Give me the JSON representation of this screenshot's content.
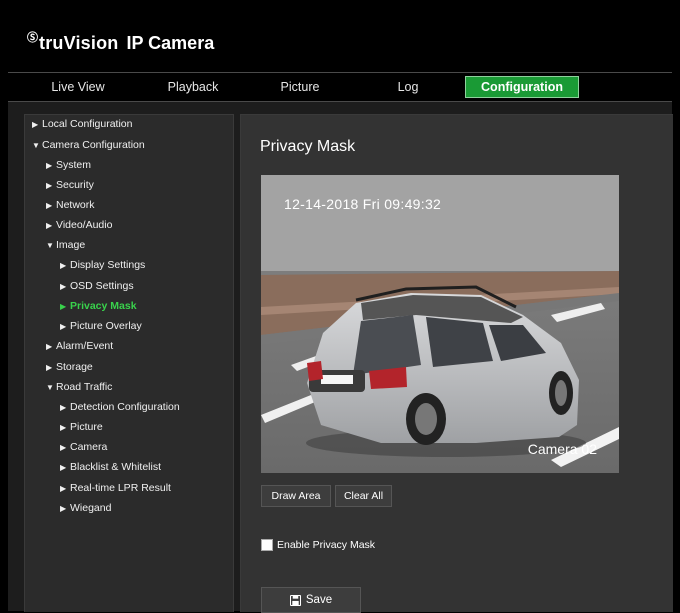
{
  "brand": {
    "mark": "Ⓢ",
    "name": "truVision",
    "product": "IP Camera"
  },
  "nav": {
    "tabs": [
      "Live View",
      "Playback",
      "Picture",
      "Log",
      "Configuration"
    ],
    "active": "Configuration"
  },
  "sidebar": {
    "items": [
      {
        "label": "Local Configuration",
        "expanded": false
      },
      {
        "label": "Camera Configuration",
        "expanded": true
      },
      {
        "label": "System",
        "expanded": false
      },
      {
        "label": "Security",
        "expanded": false
      },
      {
        "label": "Network",
        "expanded": false
      },
      {
        "label": "Video/Audio",
        "expanded": false
      },
      {
        "label": "Image",
        "expanded": true
      },
      {
        "label": "Display Settings",
        "expanded": false
      },
      {
        "label": "OSD Settings",
        "expanded": false
      },
      {
        "label": "Privacy Mask",
        "expanded": false,
        "selected": true
      },
      {
        "label": "Picture Overlay",
        "expanded": false
      },
      {
        "label": "Alarm/Event",
        "expanded": false
      },
      {
        "label": "Storage",
        "expanded": false
      },
      {
        "label": "Road Traffic",
        "expanded": true
      },
      {
        "label": "Detection Configuration",
        "expanded": false
      },
      {
        "label": "Picture",
        "expanded": false
      },
      {
        "label": "Camera",
        "expanded": false
      },
      {
        "label": "Blacklist & Whitelist",
        "expanded": false
      },
      {
        "label": "Real-time LPR Result",
        "expanded": false
      },
      {
        "label": "Wiegand",
        "expanded": false
      }
    ]
  },
  "main": {
    "title": "Privacy Mask",
    "video": {
      "osd_datetime": "12-14-2018  Fri  09:49:32",
      "osd_camera": "Camera 02"
    },
    "draw_area_label": "Draw Area",
    "clear_all_label": "Clear All",
    "enable_label": "Enable Privacy Mask",
    "enable_checked": false,
    "save_label": "Save"
  },
  "colors": {
    "accent": "#1a9a35",
    "selected_text": "#39d24c",
    "panel": "#333333",
    "sidebar": "#2b2b2b"
  },
  "icons": {
    "expanded": "triangle-down-icon",
    "collapsed": "triangle-right-icon",
    "save": "floppy-disk-icon"
  }
}
